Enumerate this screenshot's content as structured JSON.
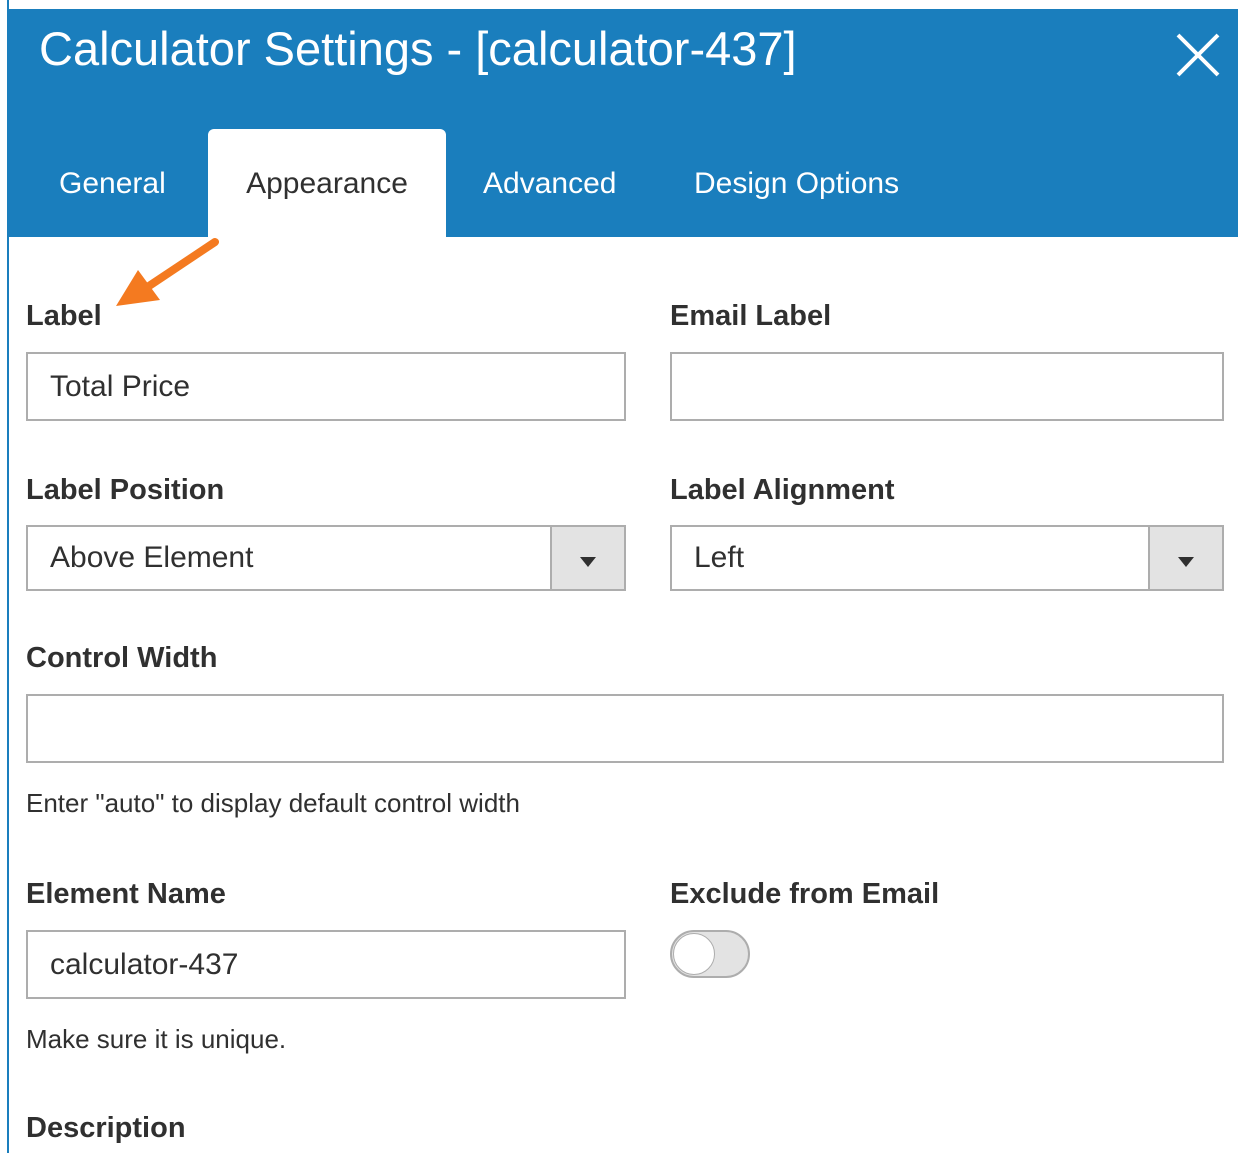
{
  "dialog": {
    "title": "Calculator Settings - [calculator-437]",
    "close_icon": "close-icon"
  },
  "tabs": [
    {
      "label": "General",
      "active": false
    },
    {
      "label": "Appearance",
      "active": true
    },
    {
      "label": "Advanced",
      "active": false
    },
    {
      "label": "Design Options",
      "active": false
    }
  ],
  "form": {
    "label": {
      "title": "Label",
      "value": "Total Price"
    },
    "email_label": {
      "title": "Email Label",
      "value": ""
    },
    "label_position": {
      "title": "Label Position",
      "value": "Above Element"
    },
    "label_alignment": {
      "title": "Label Alignment",
      "value": "Left"
    },
    "control_width": {
      "title": "Control Width",
      "value": "",
      "hint": "Enter \"auto\" to display default control width"
    },
    "element_name": {
      "title": "Element Name",
      "value": "calculator-437",
      "hint": "Make sure it is unique."
    },
    "exclude_from_email": {
      "title": "Exclude from Email",
      "checked": false
    },
    "description": {
      "title": "Description"
    }
  },
  "annotation": {
    "icon": "arrow-icon",
    "color": "#f47a20"
  },
  "colors": {
    "header": "#1a7ebd",
    "text": "#303030",
    "border": "#adadad"
  }
}
